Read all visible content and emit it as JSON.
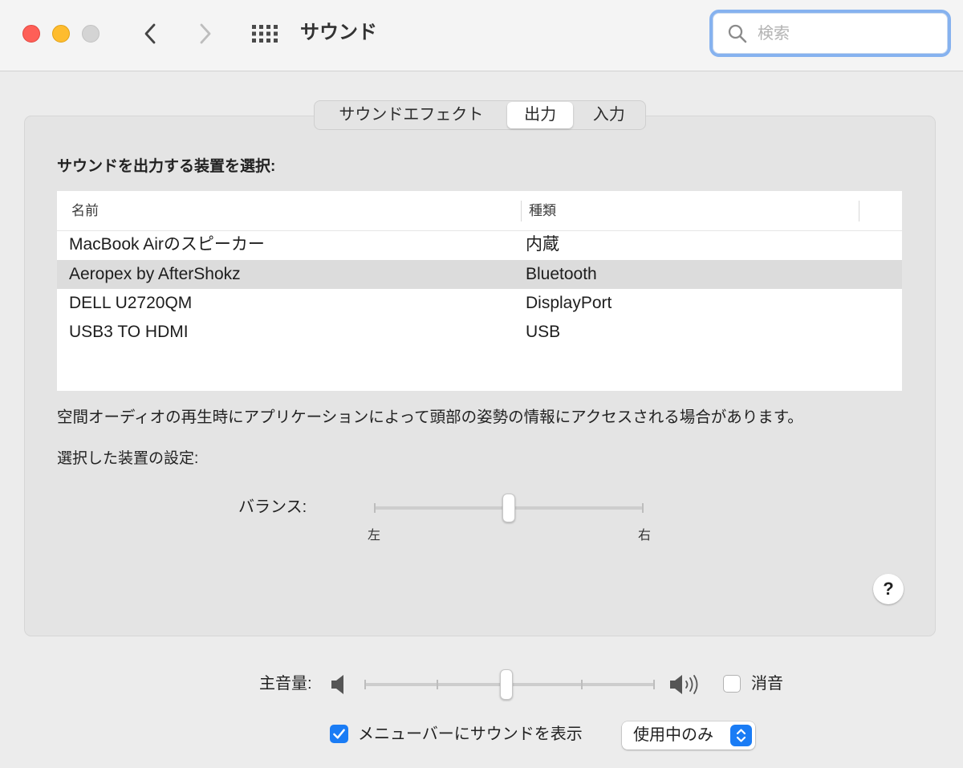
{
  "window": {
    "title": "サウンド",
    "search_placeholder": "検索"
  },
  "tabs": [
    {
      "label": "サウンドエフェクト",
      "selected": false
    },
    {
      "label": "出力",
      "selected": true
    },
    {
      "label": "入力",
      "selected": false
    }
  ],
  "output": {
    "heading": "サウンドを出力する装置を選択:",
    "columns": [
      "名前",
      "種類"
    ],
    "devices": [
      {
        "name": "MacBook Airのスピーカー",
        "type": "内蔵",
        "selected": false
      },
      {
        "name": "Aeropex by AfterShokz",
        "type": "Bluetooth",
        "selected": true
      },
      {
        "name": "DELL U2720QM",
        "type": "DisplayPort",
        "selected": false
      },
      {
        "name": "USB3 TO HDMI",
        "type": "USB",
        "selected": false
      }
    ],
    "spatial_note": "空間オーディオの再生時にアプリケーションによって頭部の姿勢の情報にアクセスされる場合があります。",
    "settings_heading": "選択した装置の設定:",
    "balance": {
      "label": "バランス:",
      "left_label": "左",
      "right_label": "右",
      "value": 0.5
    },
    "help_label": "?"
  },
  "volume": {
    "label": "主音量:",
    "value": 0.49,
    "mute_label": "消音",
    "muted": false
  },
  "menubar": {
    "label": "メニューバーにサウンドを表示",
    "checked": true,
    "popup_value": "使用中のみ"
  },
  "icons": {
    "close": "close-button-icon",
    "minimize": "minimize-button-icon",
    "zoom": "zoom-button-icon",
    "back": "chevron-left-icon",
    "forward": "chevron-right-icon",
    "all_prefs": "grid-icon",
    "search": "search-icon",
    "volume_low": "speaker-low-icon",
    "volume_high": "speaker-high-icon",
    "popup": "up-down-chevron-icon",
    "checkbox": "checkmark-icon"
  },
  "colors": {
    "accent": "#1a7cf5",
    "close": "#fe5f57",
    "minimize": "#febc2e",
    "zoom_inactive": "#d4d4d4",
    "selected_row": "#dcdcdc",
    "focus_ring": "#86b2ef"
  }
}
